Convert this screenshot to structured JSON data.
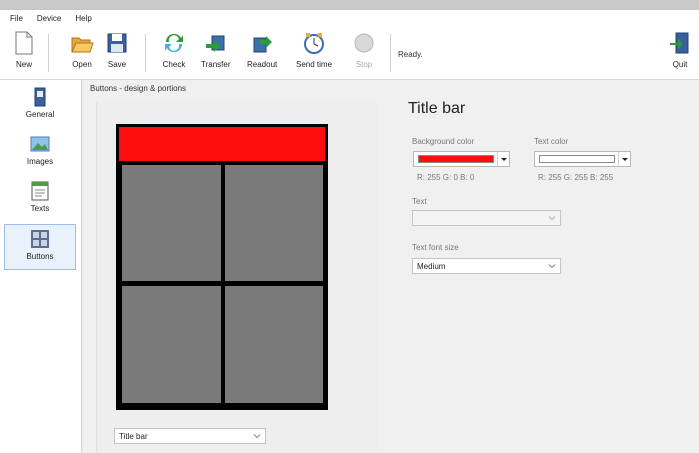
{
  "menu": [
    "File",
    "Device",
    "Help"
  ],
  "toolbar": {
    "new": "New",
    "open": "Open",
    "save": "Save",
    "check": "Check",
    "transfer": "Transfer",
    "readout": "Readout",
    "send_time": "Send time",
    "stop": "Stop",
    "quit": "Quit"
  },
  "status": "Ready.",
  "nav": {
    "general": "General",
    "images": "Images",
    "texts": "Texts",
    "buttons": "Buttons",
    "selected": "buttons"
  },
  "section_title": "Buttons - design & portions",
  "design": {
    "element_select_value": "Title bar",
    "title_bar_color": "#ff0d0d",
    "button_color": "#7a7a7a"
  },
  "properties": {
    "title": "Title bar",
    "background_color_label": "Background color",
    "background_color_value": "#ff0d0d",
    "background_rgb": "R: 255 G: 0 B: 0",
    "text_color_label": "Text color",
    "text_color_value": "#ffffff",
    "text_rgb": "R: 255 G: 255 B: 255",
    "text_label": "Text",
    "text_value": "",
    "font_size_label": "Text font size",
    "font_size_value": "Medium"
  },
  "icons": {
    "new": "new-document-icon",
    "open": "open-folder-icon",
    "save": "save-disk-icon",
    "check": "check-refresh-icon",
    "transfer": "transfer-icon",
    "readout": "readout-icon",
    "send_time": "clock-icon",
    "stop": "stop-icon",
    "quit": "quit-door-icon"
  }
}
